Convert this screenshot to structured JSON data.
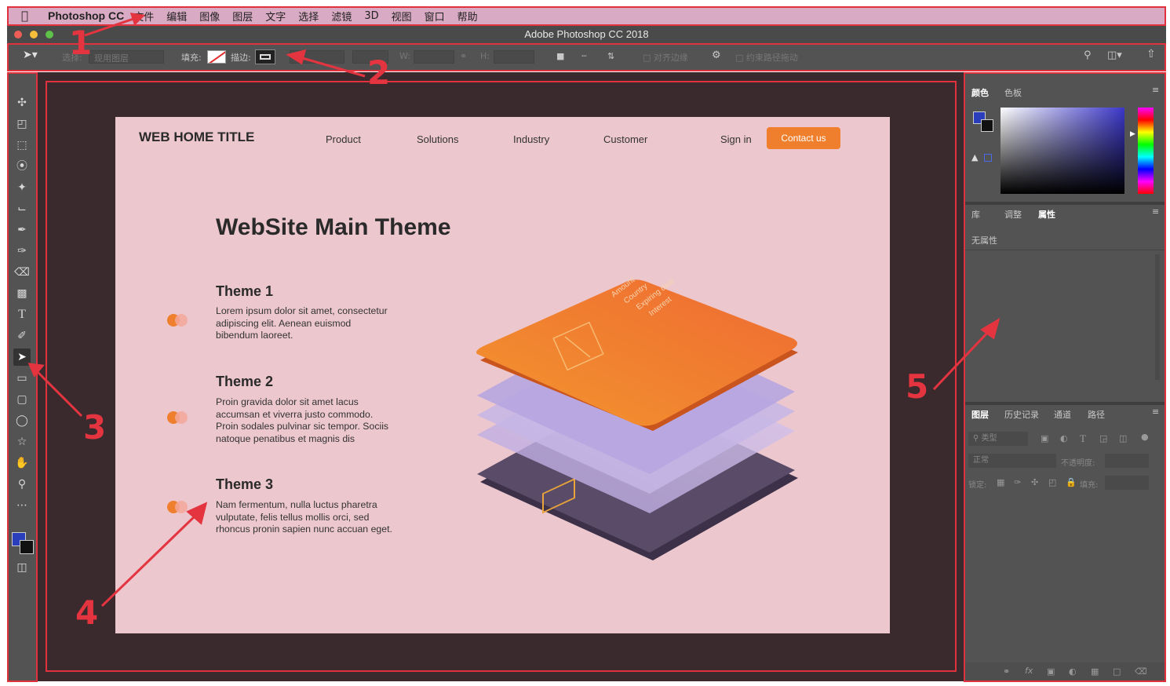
{
  "menubar": {
    "app_name": "Photoshop CC",
    "items": [
      "文件",
      "编辑",
      "图像",
      "图层",
      "文字",
      "选择",
      "滤镜",
      "3D",
      "视图",
      "窗口",
      "帮助"
    ]
  },
  "window": {
    "title": "Adobe Photoshop CC 2018"
  },
  "options_bar": {
    "select_label": "选择:",
    "select_value": "现用图层",
    "fill_label": "填充:",
    "stroke_label": "描边:",
    "w_label": "W:",
    "h_label": "H:",
    "align_edges_label": "对齐边缘",
    "constrain_label": "约束路径拖动"
  },
  "document": {
    "site_title": "WEB HOME TITLE",
    "nav": [
      "Product",
      "Solutions",
      "Industry",
      "Customer",
      "Sign in"
    ],
    "contact_label": "Contact us",
    "hero_title": "WebSite Main Theme",
    "themes": [
      {
        "title": "Theme 1",
        "lines": [
          "Lorem ipsum dolor sit amet, consectetur",
          "adipiscing elit. Aenean euismod",
          "bibendum laoreet."
        ]
      },
      {
        "title": "Theme 2",
        "lines": [
          "Proin gravida dolor sit amet lacus",
          "accumsan et viverra justo commodo.",
          "Proin sodales pulvinar sic tempor. Sociis",
          "natoque penatibus et magnis dis"
        ]
      },
      {
        "title": "Theme 3",
        "lines": [
          "Nam fermentum, nulla luctus pharetra",
          "vulputate, felis tellus mollis orci, sed",
          "rhoncus pronin sapien nunc accuan eget."
        ]
      }
    ],
    "card_text": [
      "Amount",
      "Country",
      "Expiring date",
      "Interest"
    ],
    "accent_color": "#ef7f2c"
  },
  "color_panel": {
    "tabs": [
      "颜色",
      "色板"
    ]
  },
  "properties_panel": {
    "tabs": [
      "库",
      "调整",
      "属性"
    ],
    "status": "无属性"
  },
  "layers_panel": {
    "tabs": [
      "图层",
      "历史记录",
      "通道",
      "路径"
    ],
    "filter_label": "类型",
    "blend_mode": "正常",
    "opacity_label": "不透明度:",
    "lock_label": "锁定:",
    "fill_label": "填充:"
  },
  "annotations": [
    "1",
    "2",
    "3",
    "4",
    "5"
  ]
}
